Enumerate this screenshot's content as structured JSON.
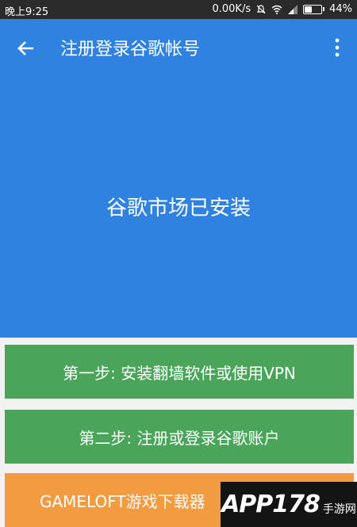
{
  "status_bar": {
    "time": "晚上9:25",
    "speed": "0.00K/s",
    "battery": "44%",
    "battery_level": 0.44,
    "icons": [
      "mute-icon",
      "wifi-icon",
      "signal-icon",
      "battery-icon"
    ]
  },
  "toolbar": {
    "title": "注册登录谷歌帐号",
    "back_icon": "arrow-back-icon",
    "menu_icon": "more-vert-icon"
  },
  "hero": {
    "message": "谷歌市场已安装"
  },
  "steps": [
    {
      "label": "第一步: 安装翻墙软件或使用VPN"
    },
    {
      "label": "第二步: 注册或登录谷歌账户"
    },
    {
      "label": "GAMELOFT游戏下载器"
    }
  ],
  "watermark": {
    "main": "APP178",
    "sub": "手游网"
  },
  "colors": {
    "status_bar": "#2a2a2a",
    "primary": "#2f82e0",
    "step_green": "#4aa45a",
    "step_orange": "#f39b40",
    "background": "#f2f2f2"
  }
}
